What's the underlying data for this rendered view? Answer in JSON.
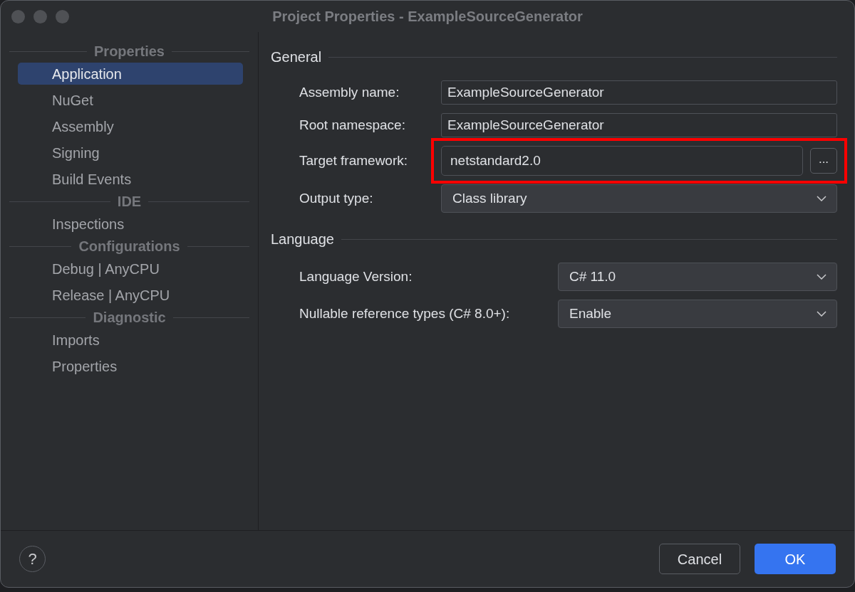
{
  "window": {
    "title": "Project Properties - ExampleSourceGenerator"
  },
  "sidebar": {
    "groups": [
      {
        "header": "Properties",
        "items": [
          {
            "label": "Application",
            "selected": true
          },
          {
            "label": "NuGet",
            "selected": false
          },
          {
            "label": "Assembly",
            "selected": false
          },
          {
            "label": "Signing",
            "selected": false
          },
          {
            "label": "Build Events",
            "selected": false
          }
        ]
      },
      {
        "header": "IDE",
        "items": [
          {
            "label": "Inspections",
            "selected": false
          }
        ]
      },
      {
        "header": "Configurations",
        "items": [
          {
            "label": "Debug | AnyCPU",
            "selected": false
          },
          {
            "label": "Release | AnyCPU",
            "selected": false
          }
        ]
      },
      {
        "header": "Diagnostic",
        "items": [
          {
            "label": "Imports",
            "selected": false
          },
          {
            "label": "Properties",
            "selected": false
          }
        ]
      }
    ]
  },
  "sections": [
    {
      "title": "General",
      "rows": [
        {
          "label": "Assembly name:",
          "kind": "text",
          "value": "ExampleSourceGenerator"
        },
        {
          "label": "Root namespace:",
          "kind": "text",
          "value": "ExampleSourceGenerator"
        },
        {
          "label": "Target framework:",
          "kind": "text_with_button",
          "value": "netstandard2.0",
          "button": "...",
          "highlighted": true
        },
        {
          "label": "Output type:",
          "kind": "dropdown",
          "value": "Class library"
        }
      ]
    },
    {
      "title": "Language",
      "rows": [
        {
          "label": "Language Version:",
          "kind": "dropdown",
          "value": "C# 11.0"
        },
        {
          "label": "Nullable reference types (C# 8.0+):",
          "kind": "dropdown",
          "value": "Enable"
        }
      ]
    }
  ],
  "footer": {
    "help": "?",
    "buttons": [
      {
        "label": "Cancel",
        "kind": "secondary"
      },
      {
        "label": "OK",
        "kind": "primary"
      }
    ]
  }
}
